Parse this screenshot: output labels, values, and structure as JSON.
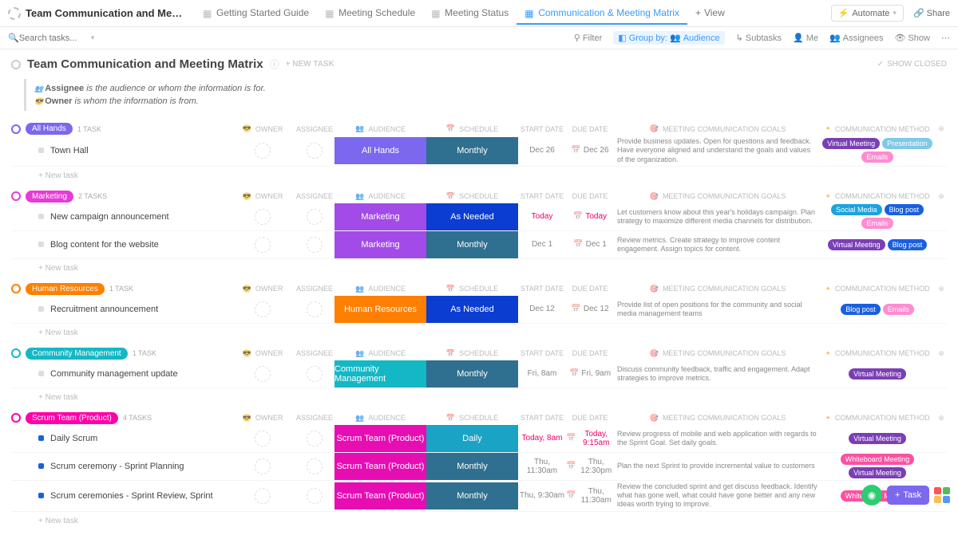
{
  "workspace_title": "Team Communication and Meeting Ma...",
  "tabs": [
    {
      "label": "Getting Started Guide",
      "active": false
    },
    {
      "label": "Meeting Schedule",
      "active": false
    },
    {
      "label": "Meeting Status",
      "active": false
    },
    {
      "label": "Communication & Meeting Matrix",
      "active": true
    },
    {
      "label": "View",
      "add": true
    }
  ],
  "automate": "Automate",
  "share": "Share",
  "search_placeholder": "Search tasks...",
  "toolbar": {
    "filter": "Filter",
    "group_by": "Group by:",
    "group_val": "Audience",
    "subtasks": "Subtasks",
    "me": "Me",
    "assignees": "Assignees",
    "show": "Show"
  },
  "page_title": "Team Communication and Meeting Matrix",
  "new_task": "+ NEW TASK",
  "show_closed": "SHOW CLOSED",
  "description": {
    "line1_b": "Assignee",
    "line1": " is the audience or whom the information is for.",
    "line2_b": "Owner",
    "line2": " is whom the information is from."
  },
  "column_headers": {
    "owner": "OWNER",
    "assignee": "ASSIGNEE",
    "audience": "AUDIENCE",
    "schedule": "SCHEDULE",
    "start": "START DATE",
    "due": "DUE DATE",
    "goals": "MEETING COMMUNICATION GOALS",
    "method": "COMMUNICATION METHOD"
  },
  "new_task_link": "+ New task",
  "groups": [
    {
      "name": "All Hands",
      "color": "#7b68ee",
      "count": "1 TASK",
      "toggle_color": "#7b68ee",
      "rows": [
        {
          "name": "Town Hall",
          "dot": "#ddd",
          "audience": "All Hands",
          "aud_color": "#7b68ee",
          "schedule": "Monthly",
          "sch_color": "#2f6f8f",
          "start": "Dec 26",
          "due": "Dec 26",
          "goals": "Provide business updates. Open for questions and feedback. Have everyone aligned and understand the goals and values of the organization.",
          "methods": [
            {
              "t": "Virtual Meeting",
              "c": "#7b3fb5"
            },
            {
              "t": "Presentation",
              "c": "#7fc9e8"
            },
            {
              "t": "Emails",
              "c": "#ff8bd1"
            }
          ]
        }
      ]
    },
    {
      "name": "Marketing",
      "color": "#e63bd6",
      "count": "2 TASKS",
      "toggle_color": "#e63bd6",
      "rows": [
        {
          "name": "New campaign announcement",
          "dot": "#ddd",
          "audience": "Marketing",
          "aud_color": "#a24be8",
          "schedule": "As Needed",
          "sch_color": "#0b3dd1",
          "start": "Today",
          "due": "Today",
          "today": true,
          "goals": "Let customers know about this year's holidays campaign. Plan strategy to maximize different media channels for distribution.",
          "methods": [
            {
              "t": "Social Media",
              "c": "#1aa3e0"
            },
            {
              "t": "Blog post",
              "c": "#1a5fe0"
            },
            {
              "t": "Emails",
              "c": "#ff8bd1"
            }
          ]
        },
        {
          "name": "Blog content for the website",
          "dot": "#ddd",
          "audience": "Marketing",
          "aud_color": "#a24be8",
          "schedule": "Monthly",
          "sch_color": "#2f6f8f",
          "start": "Dec 1",
          "due": "Dec 1",
          "goals": "Review metrics. Create strategy to improve content engagement. Assign topics for content.",
          "methods": [
            {
              "t": "Virtual Meeting",
              "c": "#7b3fb5"
            },
            {
              "t": "Blog post",
              "c": "#1a5fe0"
            }
          ]
        }
      ]
    },
    {
      "name": "Human Resources",
      "color": "#ff7f00",
      "count": "1 TASK",
      "toggle_color": "#ff7f00",
      "rows": [
        {
          "name": "Recruitment announcement",
          "dot": "#ddd",
          "audience": "Human Resources",
          "aud_color": "#ff7f00",
          "schedule": "As Needed",
          "sch_color": "#0b3dd1",
          "start": "Dec 12",
          "due": "Dec 12",
          "goals": "Provide list of open positions for the community and social media management teams",
          "methods": [
            {
              "t": "Blog post",
              "c": "#1a5fe0"
            },
            {
              "t": "Emails",
              "c": "#ff8bd1"
            }
          ]
        }
      ]
    },
    {
      "name": "Community Management",
      "color": "#14b8c4",
      "count": "1 TASK",
      "toggle_color": "#14b8c4",
      "rows": [
        {
          "name": "Community management update",
          "dot": "#ddd",
          "audience": "Community Management",
          "aud_color": "#14b8c4",
          "schedule": "Monthly",
          "sch_color": "#2f6f8f",
          "start": "Fri, 8am",
          "due": "Fri, 9am",
          "goals": "Discuss community feedback, traffic and engagement. Adapt strategies to improve metrics.",
          "methods": [
            {
              "t": "Virtual Meeting",
              "c": "#7b3fb5"
            }
          ]
        }
      ]
    },
    {
      "name": "Scrum Team (Product)",
      "color": "#ff00a8",
      "count": "4 TASKS",
      "toggle_color": "#ff00a8",
      "rows": [
        {
          "name": "Daily Scrum",
          "dot": "#1a5fe0",
          "audience": "Scrum Team (Product)",
          "aud_color": "#e60db3",
          "schedule": "Daily",
          "sch_color": "#1aa3c4",
          "start": "Today, 8am",
          "due": "Today, 9:15am",
          "today": true,
          "goals": "Review progress of mobile and web application with regards to the Sprint Goal. Set daily goals.",
          "methods": [
            {
              "t": "Virtual Meeting",
              "c": "#7b3fb5"
            }
          ]
        },
        {
          "name": "Scrum ceremony - Sprint Planning",
          "dot": "#1a5fe0",
          "audience": "Scrum Team (Product)",
          "aud_color": "#e60db3",
          "schedule": "Monthly",
          "sch_color": "#2f6f8f",
          "start": "Thu, 11:30am",
          "due": "Thu, 12:30pm",
          "goals": "Plan the next Sprint to provide incremental value to customers",
          "methods": [
            {
              "t": "Whiteboard Meeting",
              "c": "#ff4fa3"
            },
            {
              "t": "Virtual Meeting",
              "c": "#7b3fb5"
            }
          ]
        },
        {
          "name": "Scrum ceremonies - Sprint Review, Sprint",
          "dot": "#1a5fe0",
          "audience": "Scrum Team (Product)",
          "aud_color": "#e60db3",
          "schedule": "Monthly",
          "sch_color": "#2f6f8f",
          "start": "Thu, 9:30am",
          "due": "Thu, 11:30am",
          "goals": "Review the concluded sprint and get discuss feedback. Identify what has gone well, what could have gone better and any new ideas worth trying to improve.",
          "methods": [
            {
              "t": "Whiteboard Meeting",
              "c": "#ff4fa3"
            }
          ]
        }
      ]
    }
  ],
  "fab_task": "Task"
}
